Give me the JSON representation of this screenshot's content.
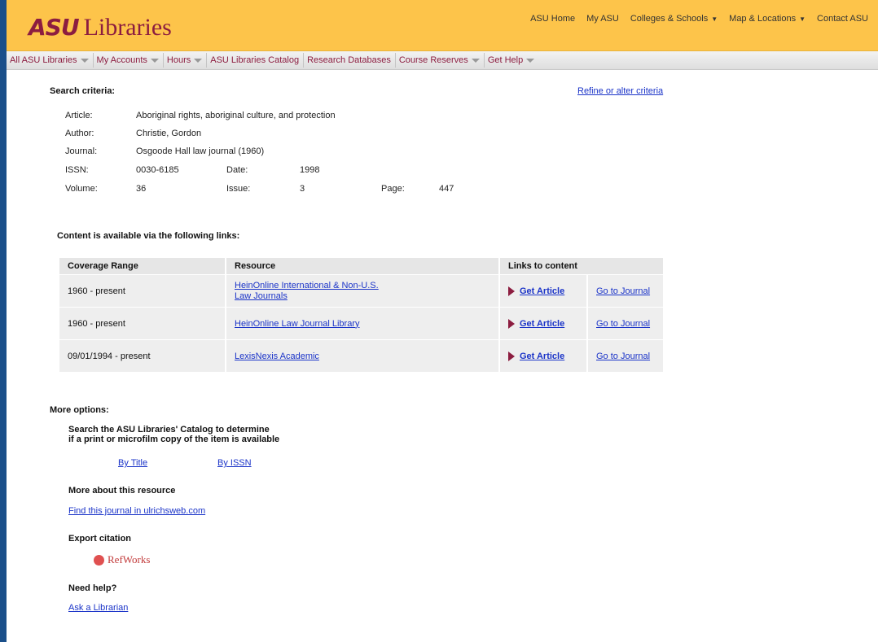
{
  "header": {
    "logo_asu": "ASU",
    "logo_libraries": "Libraries",
    "top_links": [
      "ASU Home",
      "My ASU",
      "Colleges & Schools",
      "Map & Locations",
      "Contact ASU"
    ]
  },
  "nav": [
    "All ASU Libraries",
    "My Accounts",
    "Hours",
    "ASU Libraries Catalog",
    "Research Databases",
    "Course Reserves",
    "Get Help"
  ],
  "search": {
    "title": "Search criteria:",
    "refine": "Refine or alter criteria",
    "article_label": "Article:",
    "article": "Aboriginal rights, aboriginal culture, and protection",
    "author_label": "Author:",
    "author": "Christie, Gordon",
    "journal_label": "Journal:",
    "journal": "Osgoode Hall law journal (1960)",
    "issn_label": "ISSN:",
    "issn": "0030-6185",
    "date_label": "Date:",
    "date": "1998",
    "volume_label": "Volume:",
    "volume": "36",
    "issue_label": "Issue:",
    "issue": "3",
    "page_label": "Page:",
    "page": "447"
  },
  "content": {
    "title": "Content is available via the following links:",
    "headers": [
      "Coverage Range",
      "Resource",
      "Links to content"
    ],
    "rows": [
      {
        "range": "1960 - present",
        "resource_1": "HeinOnline International & Non-U.S.",
        "resource_2": "Law Journals",
        "get": "Get Article",
        "goto": "Go to Journal"
      },
      {
        "range": "1960 - present",
        "resource_1": "HeinOnline Law Journal Library",
        "resource_2": "",
        "get": "Get Article",
        "goto": "Go to Journal"
      },
      {
        "range": "09/01/1994 - present",
        "resource_1": "LexisNexis Academic",
        "resource_2": "",
        "get": "Get Article",
        "goto": "Go to Journal"
      }
    ]
  },
  "more": {
    "title": "More options:",
    "catalog_line1": "Search the ASU Libraries' Catalog to determine",
    "catalog_line2": "if a print or microfilm copy of the item is available",
    "by_title": "By Title",
    "by_issn": "By ISSN",
    "about": "More about this resource",
    "ulrichs": "Find this journal in ulrichsweb.com",
    "export": "Export citation",
    "refworks": "RefWorks",
    "need_help": "Need help?",
    "ask": "Ask a Librarian"
  }
}
